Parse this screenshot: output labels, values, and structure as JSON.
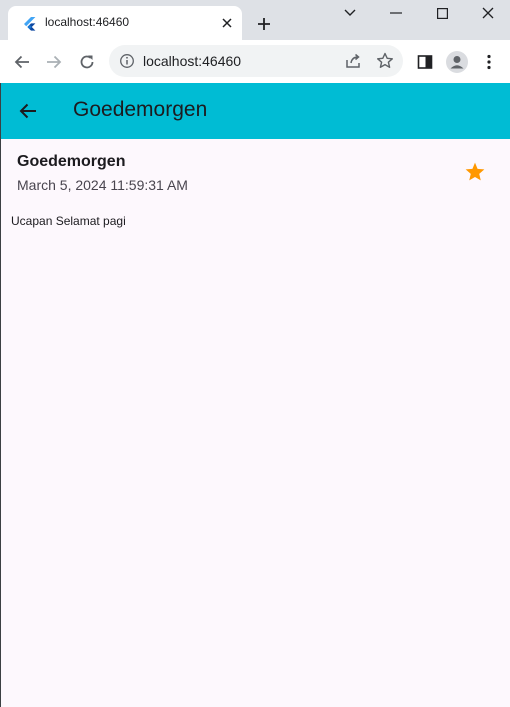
{
  "browser": {
    "tab": {
      "title": "localhost:46460"
    },
    "address_bar": {
      "url": "localhost:46460"
    }
  },
  "app_bar": {
    "title": "Goedemorgen"
  },
  "note": {
    "title": "Goedemorgen",
    "date": "March 5, 2024 11:59:31 AM",
    "body": "Ucapan Selamat pagi",
    "favorite": true
  },
  "colors": {
    "app_bar": "#00bcd4",
    "star": "#ff9800",
    "background": "#fdf8fd"
  },
  "icons": {
    "tab_favicon": "flutter-icon",
    "back": "arrow-left-icon",
    "favorite": "star-icon"
  }
}
